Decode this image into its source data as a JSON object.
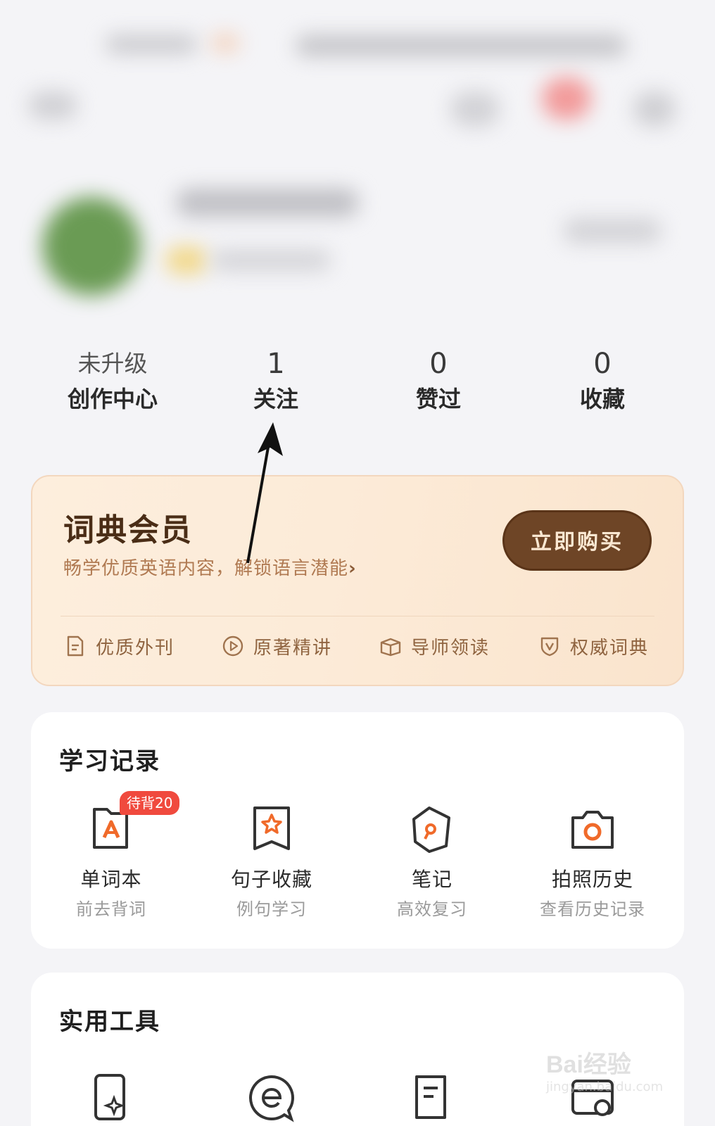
{
  "stats": [
    {
      "value": "未升级",
      "label": "创作中心"
    },
    {
      "value": "1",
      "label": "关注"
    },
    {
      "value": "0",
      "label": "赞过"
    },
    {
      "value": "0",
      "label": "收藏"
    }
  ],
  "vip": {
    "title": "词典会员",
    "subtitle": "畅学优质英语内容，解锁语言潜能",
    "subtitle_chevron": "›",
    "buy_label": "立即购买",
    "features": [
      {
        "icon": "magazine-icon",
        "label": "优质外刊"
      },
      {
        "icon": "play-circle-icon",
        "label": "原著精讲"
      },
      {
        "icon": "open-book-icon",
        "label": "导师领读"
      },
      {
        "icon": "shield-v-icon",
        "label": "权威词典"
      }
    ]
  },
  "study": {
    "title": "学习记录",
    "items": [
      {
        "icon": "wordbook-icon",
        "title": "单词本",
        "subtitle": "前去背词",
        "badge": "待背20"
      },
      {
        "icon": "sentence-star-icon",
        "title": "句子收藏",
        "subtitle": "例句学习"
      },
      {
        "icon": "note-pen-icon",
        "title": "笔记",
        "subtitle": "高效复习"
      },
      {
        "icon": "camera-icon",
        "title": "拍照历史",
        "subtitle": "查看历史记录"
      }
    ]
  },
  "tools": {
    "title": "实用工具",
    "items": [
      {
        "icon": "phone-sparkle-icon"
      },
      {
        "icon": "translate-bubble-icon"
      },
      {
        "icon": "document-icon"
      },
      {
        "icon": "refresh-card-icon"
      }
    ]
  },
  "watermark": {
    "brand": "Bai经验",
    "url": "jingyan.baidu.com"
  },
  "colors": {
    "accent": "#6e4526",
    "badge": "#f04a3e",
    "icon_orange": "#f06a2a"
  }
}
